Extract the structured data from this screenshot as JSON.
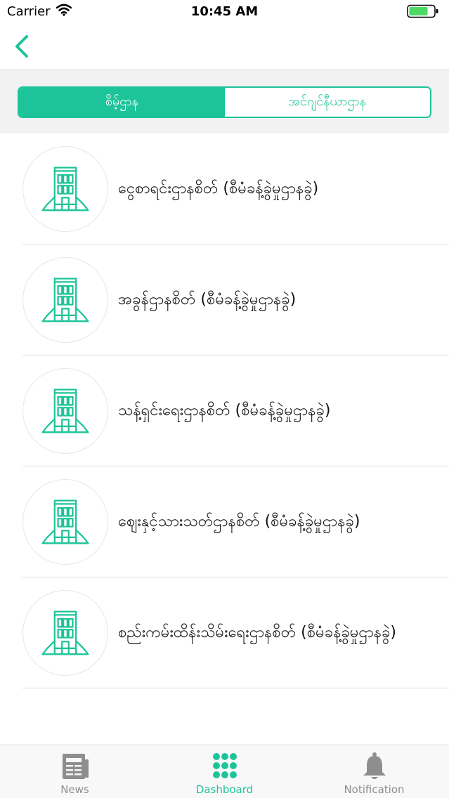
{
  "status_bar": {
    "carrier": "Carrier",
    "time": "10:45 AM",
    "battery_color": "#4cd964"
  },
  "nav": {
    "back_icon": "chevron-left-icon"
  },
  "segments": [
    {
      "label": "စိမ့်ဌာန",
      "active": true
    },
    {
      "label": "အင်ဂျင်နီယာဌာန",
      "active": false
    }
  ],
  "items": [
    {
      "label": "ငွေစာရင်းဌာနစိတ် (စီမံခန့်ခွဲမှုဌာနခွဲ)",
      "icon": "building-icon"
    },
    {
      "label": "အခွန်ဌာနစိတ် (စီမံခန့်ခွဲမှုဌာနခွဲ)",
      "icon": "building-icon"
    },
    {
      "label": "သန့်ရှင်းရေးဌာနစိတ် (စီမံခန့်ခွဲမှုဌာနခွဲ)",
      "icon": "building-icon"
    },
    {
      "label": "ဈေးနှင့်သားသတ်ဌာနစိတ် (စီမံခန့်ခွဲမှုဌာနခွဲ)",
      "icon": "building-icon"
    },
    {
      "label": "စည်းကမ်းထိန်းသိမ်းရေးဌာနစိတ် (စီမံခန့်ခွဲမှုဌာနခွဲ)",
      "icon": "building-icon"
    }
  ],
  "tabs": [
    {
      "label": "News",
      "icon": "newspaper-icon",
      "active": false
    },
    {
      "label": "Dashboard",
      "icon": "grid-dots-icon",
      "active": true
    },
    {
      "label": "Notification",
      "icon": "bell-icon",
      "active": false
    }
  ],
  "colors": {
    "accent": "#1ec499",
    "inactive_tab": "#8e8e8e",
    "segment_background": "#f2f2f2"
  }
}
